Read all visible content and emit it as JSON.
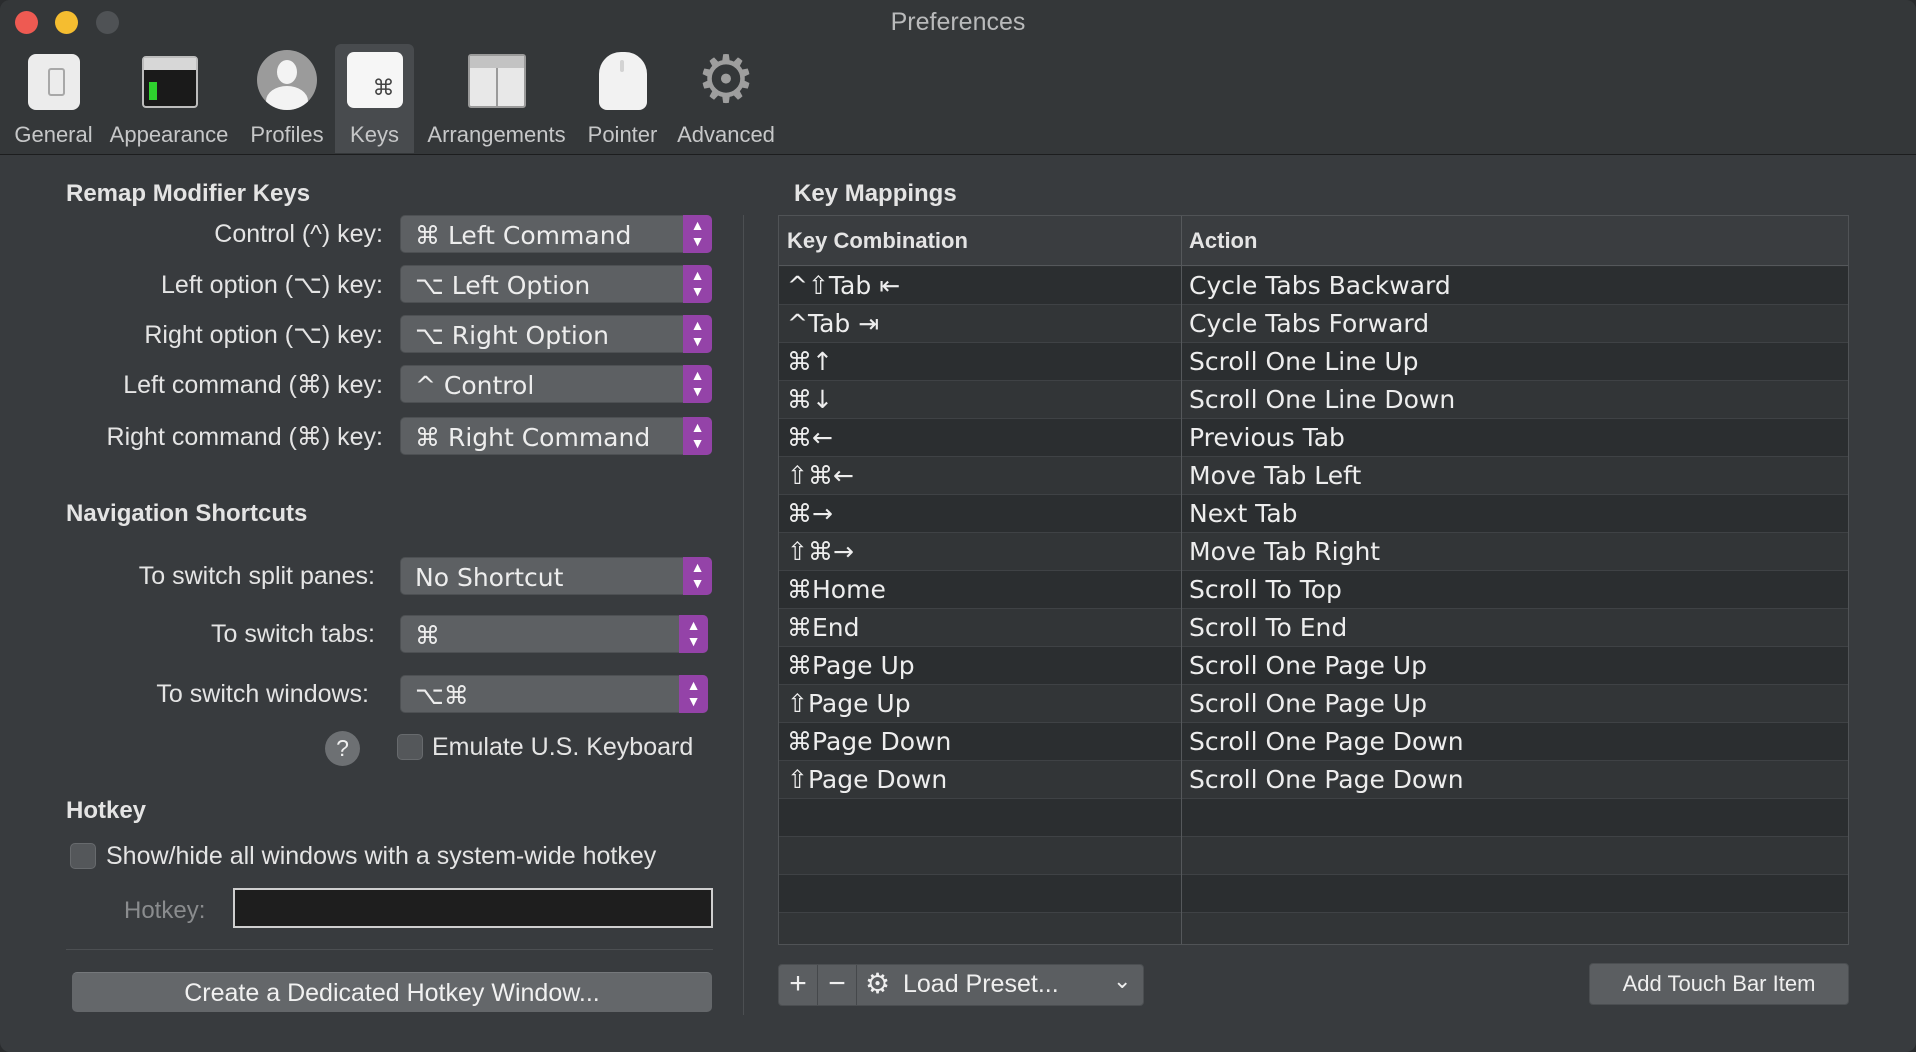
{
  "window": {
    "title": "Preferences"
  },
  "toolbar": {
    "items": [
      {
        "label": "General",
        "icon": "general-icon"
      },
      {
        "label": "Appearance",
        "icon": "appearance-icon"
      },
      {
        "label": "Profiles",
        "icon": "profiles-icon"
      },
      {
        "label": "Keys",
        "icon": "keys-icon",
        "selected": true
      },
      {
        "label": "Arrangements",
        "icon": "arrangements-icon"
      },
      {
        "label": "Pointer",
        "icon": "pointer-icon"
      },
      {
        "label": "Advanced",
        "icon": "advanced-icon"
      }
    ],
    "keys_glyph": "⌘"
  },
  "remap": {
    "title": "Remap Modifier Keys",
    "rows": [
      {
        "label": "Control (^) key:",
        "value": "⌘ Left Command"
      },
      {
        "label": "Left option (⌥) key:",
        "value": "⌥ Left Option"
      },
      {
        "label": "Right option (⌥) key:",
        "value": "⌥ Right Option"
      },
      {
        "label": "Left command (⌘) key:",
        "value": "^ Control"
      },
      {
        "label": "Right command (⌘) key:",
        "value": "⌘ Right Command"
      }
    ]
  },
  "navigation": {
    "title": "Navigation Shortcuts",
    "rows": [
      {
        "label": "To switch split panes:",
        "value": "No Shortcut"
      },
      {
        "label": "To switch tabs:",
        "value": "⌘"
      },
      {
        "label": "To switch windows:",
        "value": "⌥⌘"
      }
    ],
    "help": "?",
    "emulate_label": "Emulate U.S. Keyboard"
  },
  "hotkey": {
    "title": "Hotkey",
    "show_hide_label": "Show/hide all windows with a system-wide hotkey",
    "field_label": "Hotkey:",
    "create_button": "Create a Dedicated Hotkey Window..."
  },
  "mappings": {
    "title": "Key Mappings",
    "columns": [
      "Key Combination",
      "Action"
    ],
    "rows": [
      {
        "key": "^⇧Tab ⇤",
        "action": "Cycle Tabs Backward"
      },
      {
        "key": "^Tab ⇥",
        "action": "Cycle Tabs Forward"
      },
      {
        "key": "⌘↑",
        "action": "Scroll One Line Up"
      },
      {
        "key": "⌘↓",
        "action": "Scroll One Line Down"
      },
      {
        "key": "⌘←",
        "action": "Previous Tab"
      },
      {
        "key": "⇧⌘←",
        "action": "Move Tab Left"
      },
      {
        "key": "⌘→",
        "action": "Next Tab"
      },
      {
        "key": "⇧⌘→",
        "action": "Move Tab Right"
      },
      {
        "key": "⌘Home",
        "action": "Scroll To Top"
      },
      {
        "key": "⌘End",
        "action": "Scroll To End"
      },
      {
        "key": "⌘Page Up",
        "action": "Scroll One Page Up"
      },
      {
        "key": "⇧Page Up",
        "action": "Scroll One Page Up"
      },
      {
        "key": "⌘Page Down",
        "action": "Scroll One Page Down"
      },
      {
        "key": "⇧Page Down",
        "action": "Scroll One Page Down"
      },
      {
        "key": "",
        "action": ""
      },
      {
        "key": "",
        "action": ""
      },
      {
        "key": "",
        "action": ""
      },
      {
        "key": "",
        "action": ""
      }
    ]
  },
  "bottom": {
    "add": "+",
    "remove": "−",
    "load_preset": "Load Preset...",
    "add_touch_bar": "Add Touch Bar Item"
  },
  "colors": {
    "accent": "#9443a8",
    "close": "#ee5a52",
    "minimize": "#f5bd30",
    "background": "#383b3e"
  }
}
